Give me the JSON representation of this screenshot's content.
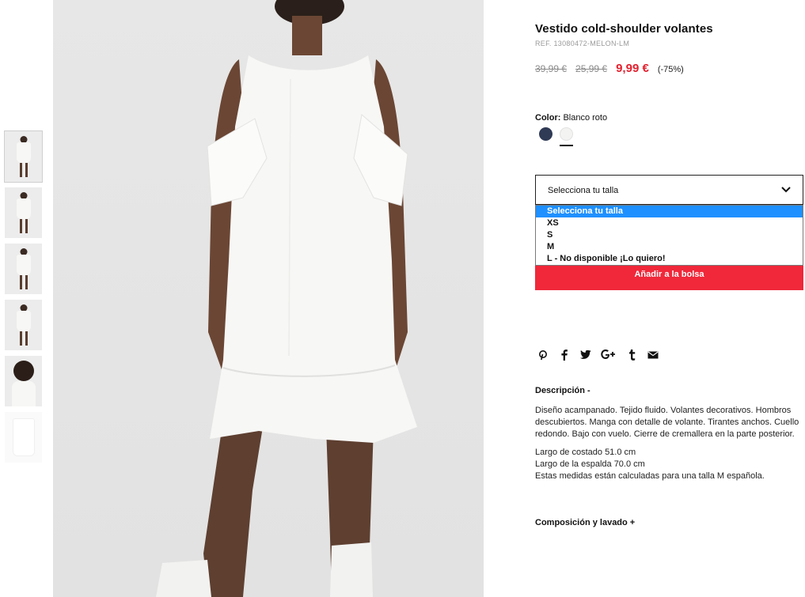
{
  "thumbnails": [
    {
      "alt": "thumb-1"
    },
    {
      "alt": "thumb-2"
    },
    {
      "alt": "thumb-3"
    },
    {
      "alt": "thumb-4"
    },
    {
      "alt": "thumb-5"
    },
    {
      "alt": "thumb-6"
    }
  ],
  "product": {
    "title": "Vestido cold-shoulder volantes",
    "ref": "REF. 13080472-MELON-LM",
    "price_original": "39,99 €",
    "price_previous": "25,99 €",
    "price_current": "9,99 €",
    "discount": "(-75%)"
  },
  "color": {
    "label": "Color:",
    "value": "Blanco roto",
    "swatches": [
      {
        "name": "navy",
        "hex": "#2f3a55"
      },
      {
        "name": "blanco roto",
        "hex": "#f3f3f1"
      }
    ]
  },
  "size_select": {
    "selected": "Selecciona tu talla",
    "options": [
      "Selecciona tu talla",
      "XS",
      "S",
      "M",
      "L - No disponible ¡Lo quiero!"
    ]
  },
  "add_to_bag": "Añadir a la bolsa",
  "share_icons": [
    "pinterest-icon",
    "facebook-icon",
    "twitter-icon",
    "google-plus-icon",
    "tumblr-icon",
    "email-icon"
  ],
  "description": {
    "title": "Descripción -",
    "paragraph1": "Diseño acampanado. Tejido fluido. Volantes decorativos. Hombros descubiertos. Manga con detalle de volante. Tirantes anchos. Cuello redondo. Bajo con vuelo. Cierre de cremallera en la parte posterior.",
    "measure1": "Largo de costado 51.0 cm",
    "measure2": "Largo de la espalda 70.0 cm",
    "measure3": "Estas medidas están calculadas para una talla M española."
  },
  "composition_title": "Composición y lavado +",
  "colors": {
    "accent": "#f0283a",
    "price_sale": "#e4212f",
    "select_highlight": "#1e90ff"
  }
}
